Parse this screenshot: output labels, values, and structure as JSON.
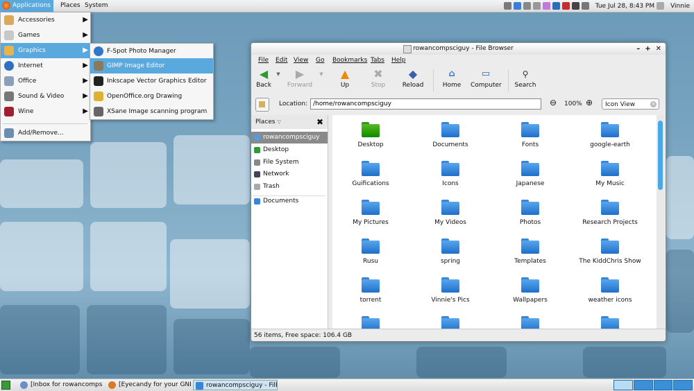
{
  "top_panel": {
    "menus": [
      "Applications",
      "Places",
      "System"
    ],
    "clock": "Tue Jul 28,  8:43 PM",
    "user": "Vinnie"
  },
  "app_menu": {
    "items": [
      {
        "label": "Accessories",
        "icon": "accessories-icon",
        "submenu": true
      },
      {
        "label": "Games",
        "icon": "games-icon",
        "submenu": true
      },
      {
        "label": "Graphics",
        "icon": "graphics-icon",
        "submenu": true,
        "selected": true
      },
      {
        "label": "Internet",
        "icon": "internet-icon",
        "submenu": true
      },
      {
        "label": "Office",
        "icon": "office-icon",
        "submenu": true
      },
      {
        "label": "Sound & Video",
        "icon": "sound-video-icon",
        "submenu": true
      },
      {
        "label": "Wine",
        "icon": "wine-icon",
        "submenu": true
      }
    ],
    "add_remove": "Add/Remove..."
  },
  "graphics_submenu": {
    "items": [
      {
        "label": "F-Spot Photo Manager",
        "icon": "f-spot-icon"
      },
      {
        "label": "GIMP Image Editor",
        "icon": "gimp-icon",
        "selected": true
      },
      {
        "label": "Inkscape Vector Graphics Editor",
        "icon": "inkscape-icon"
      },
      {
        "label": "OpenOffice.org Drawing",
        "icon": "openoffice-draw-icon"
      },
      {
        "label": "XSane Image scanning program",
        "icon": "xsane-icon"
      }
    ]
  },
  "window": {
    "title": "rowancompsciguy - File Browser",
    "menubar": [
      "File",
      "Edit",
      "View",
      "Go",
      "Bookmarks",
      "Tabs",
      "Help"
    ],
    "toolbar": {
      "back": "Back",
      "forward": "Forward",
      "up": "Up",
      "stop": "Stop",
      "reload": "Reload",
      "home": "Home",
      "computer": "Computer",
      "search": "Search"
    },
    "location_label": "Location:",
    "location_value": "/home/rowancompsciguy",
    "zoom": "100%",
    "view_mode": "Icon View",
    "sidebar": {
      "header": "Places",
      "items": [
        "rowancompsciguy",
        "Desktop",
        "File System",
        "Network",
        "Trash"
      ],
      "bookmarks": [
        "Documents"
      ]
    },
    "files": [
      "Desktop",
      "Documents",
      "Fonts",
      "google-earth",
      "Guifications",
      "Icons",
      "Japanese",
      "My Music",
      "My Pictures",
      "My Videos",
      "Photos",
      "Research Projects",
      "Rusu",
      "spring",
      "Templates",
      "The KiddChris Show",
      "torrent",
      "Vinnie's Pics",
      "Wallpapers",
      "weather icons",
      "",
      "",
      "",
      ""
    ],
    "status": "56 items, Free space: 106.4 GB"
  },
  "taskbar": {
    "tasks": [
      {
        "label": "[Inbox for rowancompsЁ",
        "icon": "thunderbird-icon"
      },
      {
        "label": "[Eyecandy for your GNЁ",
        "icon": "firefox-icon"
      },
      {
        "label": "rowancompsciguy - FilЁ",
        "icon": "folder-icon",
        "active": true
      }
    ]
  }
}
